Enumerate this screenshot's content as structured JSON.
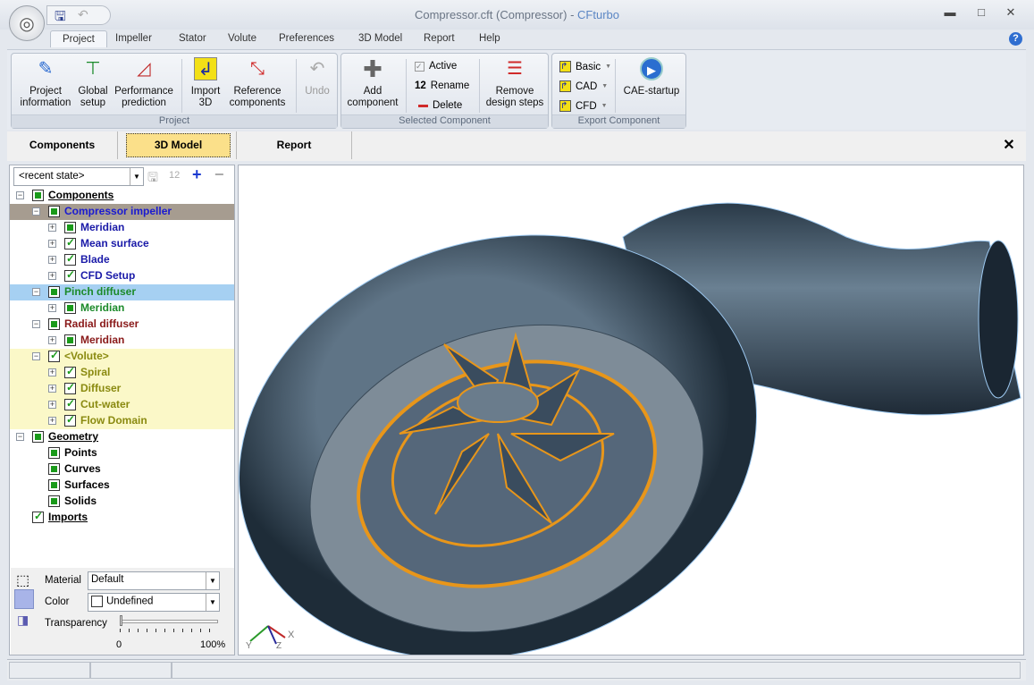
{
  "window": {
    "title_main": "Compressor.cft (Compressor) - ",
    "title_brand": "CFturbo",
    "minimize": "▬",
    "maximize": "□",
    "close": "✕"
  },
  "ribbon_tabs": [
    "Project",
    "Impeller",
    "Stator",
    "Volute",
    "Preferences",
    "3D Model",
    "Report",
    "Help"
  ],
  "help": "?",
  "groups": {
    "project": {
      "label": "Project",
      "buttons": [
        "Project information",
        "Global setup",
        "Performance prediction",
        "Import 3D",
        "Reference components",
        "Undo"
      ]
    },
    "selected": {
      "label": "Selected Component",
      "add": "Add component",
      "active": "Active",
      "rename": "Rename",
      "rename_icon": "12",
      "delete": "Delete",
      "remove": "Remove design steps"
    },
    "export": {
      "label": "Export Component",
      "basic": "Basic",
      "cad": "CAD",
      "cfd": "CFD",
      "cae": "CAE-startup"
    }
  },
  "panel_tabs": [
    "Components",
    "3D Model",
    "Report"
  ],
  "panel_close": "✕",
  "state_combo": "<recent state>",
  "state_number_icon": "12",
  "tree": [
    {
      "label": "Components",
      "level": 0,
      "exp": "−",
      "cb": "fill",
      "color": "#000000",
      "underline": true
    },
    {
      "label": "Compressor impeller",
      "level": 1,
      "exp": "−",
      "cb": "fill",
      "color": "#1a1ad0",
      "bg": "#a69c90"
    },
    {
      "label": "Meridian",
      "level": 2,
      "exp": "+",
      "cb": "fill",
      "color": "#1a1aa8"
    },
    {
      "label": "Mean surface",
      "level": 2,
      "exp": "+",
      "cb": "chk",
      "color": "#1a1aa8"
    },
    {
      "label": "Blade",
      "level": 2,
      "exp": "+",
      "cb": "chk",
      "color": "#1a1aa8"
    },
    {
      "label": "CFD Setup",
      "level": 2,
      "exp": "+",
      "cb": "chk",
      "color": "#1a1aa8"
    },
    {
      "label": "Pinch diffuser",
      "level": 1,
      "exp": "−",
      "cb": "fill",
      "color": "#1c8a2a",
      "bg": "#a6d0f2"
    },
    {
      "label": "Meridian",
      "level": 2,
      "exp": "+",
      "cb": "fill",
      "color": "#1c8a2a"
    },
    {
      "label": "Radial diffuser",
      "level": 1,
      "exp": "−",
      "cb": "fill",
      "color": "#8a1a1a"
    },
    {
      "label": "Meridian",
      "level": 2,
      "exp": "+",
      "cb": "fill",
      "color": "#8a1a1a"
    },
    {
      "label": "<Volute>",
      "level": 1,
      "exp": "−",
      "cb": "chk",
      "color": "#8a8a10",
      "bg": "#fbf8c8"
    },
    {
      "label": "Spiral",
      "level": 2,
      "exp": "+",
      "cb": "chk",
      "color": "#8a8a10",
      "bg": "#fbf8c8"
    },
    {
      "label": "Diffuser",
      "level": 2,
      "exp": "+",
      "cb": "chk",
      "color": "#8a8a10",
      "bg": "#fbf8c8"
    },
    {
      "label": "Cut-water",
      "level": 2,
      "exp": "+",
      "cb": "chk",
      "color": "#8a8a10",
      "bg": "#fbf8c8"
    },
    {
      "label": "Flow Domain",
      "level": 2,
      "exp": "+",
      "cb": "chk",
      "color": "#8a8a10",
      "bg": "#fbf8c8"
    },
    {
      "label": "Geometry",
      "level": 0,
      "exp": "−",
      "cb": "fill",
      "color": "#000000",
      "underline": true
    },
    {
      "label": "Points",
      "level": 1,
      "cb": "fill",
      "color": "#000000"
    },
    {
      "label": "Curves",
      "level": 1,
      "cb": "fill",
      "color": "#000000"
    },
    {
      "label": "Surfaces",
      "level": 1,
      "cb": "fill",
      "color": "#000000"
    },
    {
      "label": "Solids",
      "level": 1,
      "cb": "fill",
      "color": "#000000"
    },
    {
      "label": "Imports",
      "level": 0,
      "cb": "chk",
      "color": "#000000",
      "underline": true
    }
  ],
  "props": {
    "material_label": "Material",
    "material_value": "Default",
    "color_label": "Color",
    "color_value": "Undefined",
    "transparency_label": "Transparency",
    "transparency_min": "0",
    "transparency_max": "100%",
    "transparency_value": 0
  },
  "axes": {
    "x": "X",
    "y": "Y",
    "z": "Z"
  }
}
